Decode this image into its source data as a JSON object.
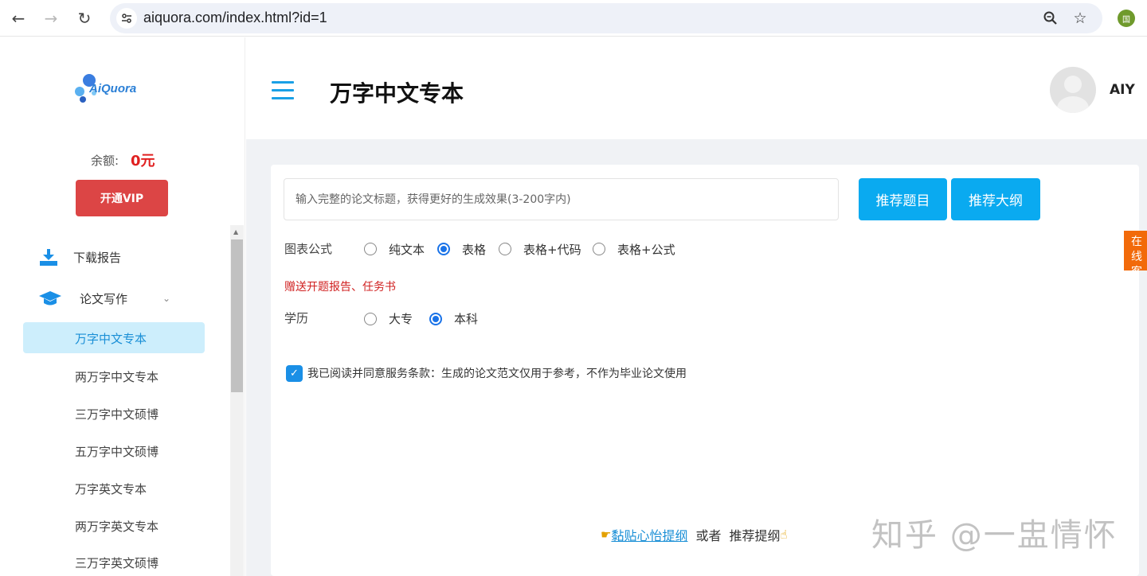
{
  "browser": {
    "url": "aiquora.com/index.html?id=1",
    "profile_letter": "国"
  },
  "sidebar": {
    "logo_text": "AiQuora",
    "balance_label": "余额:",
    "balance_value": "0元",
    "vip_button": "开通VIP",
    "menu": [
      {
        "label": "下载报告",
        "icon": "download-icon"
      },
      {
        "label": "论文写作",
        "icon": "graduation-cap-icon"
      }
    ],
    "submenu": [
      "万字中文专本",
      "两万字中文专本",
      "三万字中文硕博",
      "五万字中文硕博",
      "万字英文专本",
      "两万字英文专本",
      "三万字英文硕博"
    ]
  },
  "header": {
    "title": "万字中文专本",
    "username": "AIY"
  },
  "form": {
    "title_placeholder": "输入完整的论文标题，获得更好的生成效果(3-200字内)",
    "recommend_topic": "推荐题目",
    "recommend_outline": "推荐大纲",
    "chart_label": "图表公式",
    "chart_options": [
      "纯文本",
      "表格",
      "表格+代码",
      "表格+公式"
    ],
    "chart_selected": "表格",
    "gift_text": "赠送开题报告、任务书",
    "degree_label": "学历",
    "degree_options": [
      "大专",
      "本科"
    ],
    "degree_selected": "本科",
    "agree_text": "我已阅读并同意服务条款：生成的论文范文仅用于参考，不作为毕业论文使用",
    "paste_link": "黏贴心怡提纲",
    "or_text": "或者",
    "recommend_outline_text": "推荐提纲"
  },
  "service_tab": "在线客服",
  "watermark": "知乎 @一盅情怀"
}
